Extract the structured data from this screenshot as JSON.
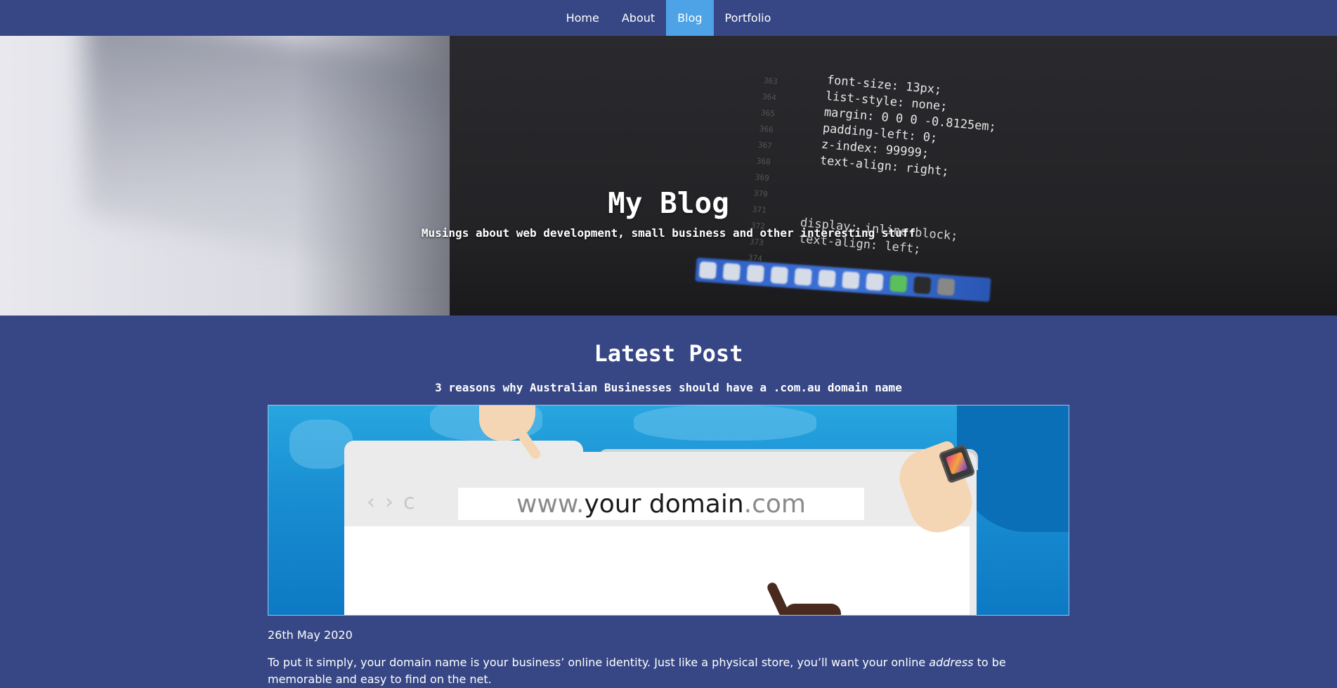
{
  "nav": {
    "items": [
      {
        "label": "Home",
        "active": false
      },
      {
        "label": "About",
        "active": false
      },
      {
        "label": "Blog",
        "active": true
      },
      {
        "label": "Portfolio",
        "active": false
      }
    ]
  },
  "hero": {
    "title": "My Blog",
    "subtitle": "Musings about web development, small business and other interesting stuff",
    "background_code": [
      "font-size: 13px;",
      "list-style: none;",
      "margin: 0 0 0 -0.8125em;",
      "padding-left: 0;",
      "z-index: 99999;",
      "text-align: right;",
      "display: inline-block;",
      "text-align: left;"
    ]
  },
  "latest": {
    "section_title": "Latest Post",
    "post": {
      "title": "3 reasons why Australian Businesses should have a .com.au domain name",
      "image": {
        "url_prefix": "www.",
        "url_domain": "your domain",
        "url_suffix": ".com"
      },
      "date": "26th May 2020",
      "excerpt_before": "To put it simply, your domain name is your business’ online identity. Just like a physical store, you’ll want your online ",
      "excerpt_em": "address",
      "excerpt_after": " to be memorable and easy to find on the net."
    }
  },
  "colors": {
    "page_bg": "#374785",
    "nav_active": "#4da3e6",
    "text": "#ffffff"
  }
}
